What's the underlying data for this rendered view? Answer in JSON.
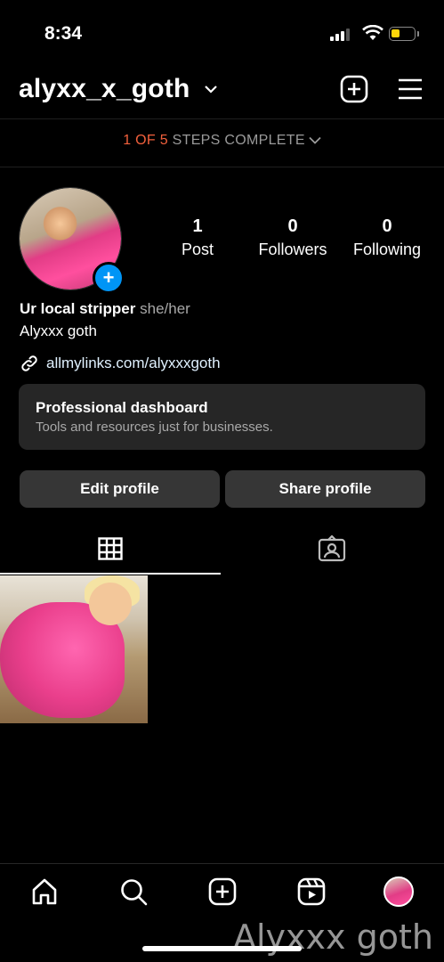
{
  "status_bar": {
    "time": "8:34"
  },
  "header": {
    "username": "alyxx_x_goth"
  },
  "steps": {
    "done": "1 OF 5",
    "rest": " STEPS COMPLETE"
  },
  "stats": [
    {
      "value": "1",
      "label": "Post"
    },
    {
      "value": "0",
      "label": "Followers"
    },
    {
      "value": "0",
      "label": "Following"
    }
  ],
  "bio": {
    "name": "Ur local stripper",
    "pronouns": "she/her",
    "line": "Alyxxx goth",
    "link": "allmylinks.com/alyxxxgoth"
  },
  "dashboard": {
    "title": "Professional dashboard",
    "subtitle": "Tools and resources just for businesses."
  },
  "buttons": {
    "edit": "Edit profile",
    "share": "Share profile"
  },
  "colors": {
    "accent": "#0095f6",
    "steps_done": "#f2603c",
    "battery": "#ffd60a"
  },
  "nav": {
    "icons": [
      "home-icon",
      "search-icon",
      "create-icon",
      "reels-icon",
      "profile-avatar"
    ]
  },
  "watermark": "Alyxxx goth"
}
